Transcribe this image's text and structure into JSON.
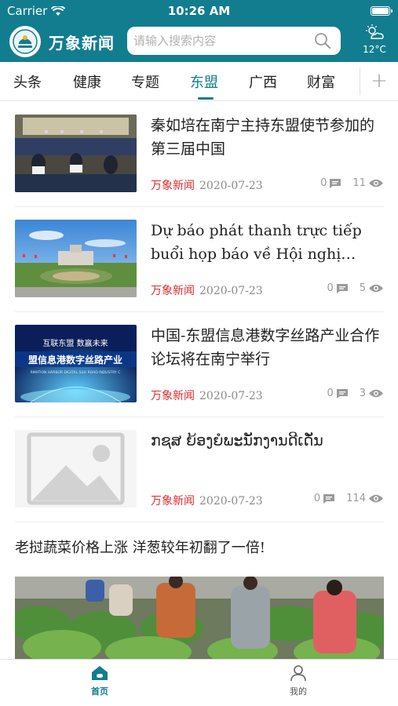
{
  "status_bar": {
    "carrier": "Carrier",
    "time": "10:26 AM",
    "battery_level": 1.0
  },
  "header": {
    "app_title": "万象新闻",
    "search_placeholder": "请输入搜索内容",
    "weather": {
      "temperature": "12°C",
      "icon": "sun-cloud-icon"
    }
  },
  "tabs": [
    {
      "label": "头条",
      "active": false
    },
    {
      "label": "健康",
      "active": false
    },
    {
      "label": "专题",
      "active": false
    },
    {
      "label": "东盟",
      "active": true
    },
    {
      "label": "广西",
      "active": false
    },
    {
      "label": "财富",
      "active": false
    }
  ],
  "tab_add_label": "+",
  "articles": [
    {
      "title": "秦如培在南宁主持东盟使节参加的第三届中国",
      "source": "万象新闻",
      "date": "2020-07-23",
      "comments": "0",
      "views": "11"
    },
    {
      "title": "Dự báo phát thanh trực tiếp buổi họp báo về Hội nghị thượng đỉnh",
      "source": "万象新闻",
      "date": "2020-07-23",
      "comments": "0",
      "views": "5"
    },
    {
      "title": "中国-东盟信息港数字丝路产业合作论坛将在南宁举行",
      "source": "万象新闻",
      "date": "2020-07-23",
      "comments": "0",
      "views": "3",
      "image_text_top": "互联东盟    数赢未来",
      "image_text_main": "盟信息港数字丝路产业",
      "image_text_sub": "RMATION HARBOR DIGITAL SILK ROAD INDUSTRY C"
    },
    {
      "title": "ກຊສ ຍ້ອງຍໍພະນັກງານດີເດັ່ນ",
      "source": "万象新闻",
      "date": "2020-07-23",
      "comments": "0",
      "views": "114"
    }
  ],
  "featured": {
    "title": "老挝蔬菜价格上涨 洋葱较年初翻了一倍!"
  },
  "bottom_nav": [
    {
      "label": "首页",
      "icon": "home-icon",
      "active": true
    },
    {
      "label": "我的",
      "icon": "person-icon",
      "active": false
    }
  ],
  "colors": {
    "brand": "#127d8f",
    "source": "#e02b2b",
    "meta": "#8a8a8a"
  }
}
